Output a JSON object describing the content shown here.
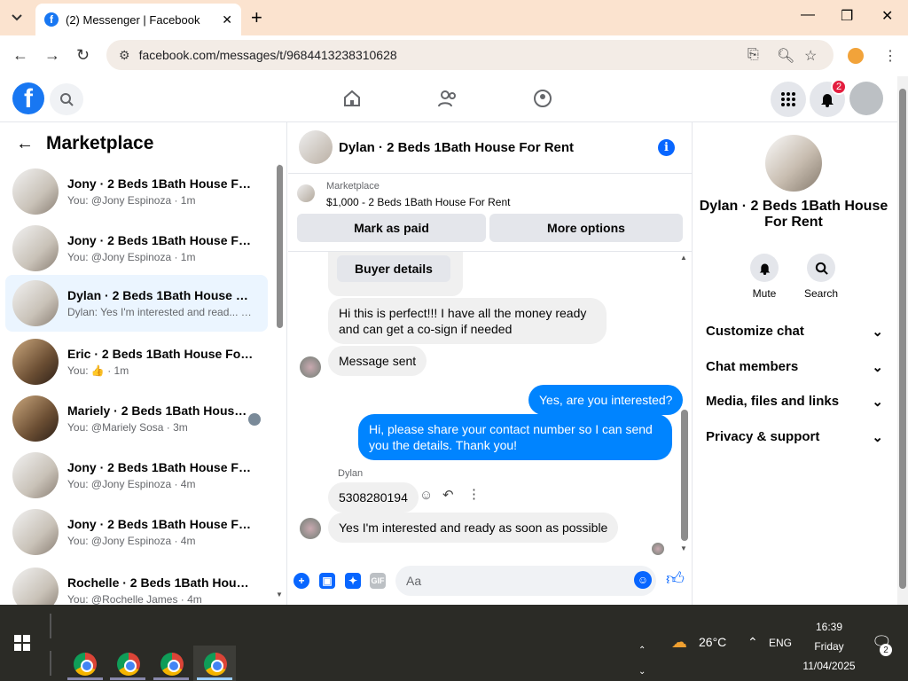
{
  "browser": {
    "tab_title": "(2) Messenger | Facebook",
    "url": "facebook.com/messages/t/9684413238310628"
  },
  "fb_header": {
    "notif_count": "2"
  },
  "left": {
    "title": "Marketplace",
    "conversations": [
      {
        "name": "Jony · 2 Beds 1Bath House For R...",
        "sub": "You: @Jony Espinoza · 1m"
      },
      {
        "name": "Jony · 2 Beds 1Bath House For R...",
        "sub": "You: @Jony Espinoza · 1m"
      },
      {
        "name": "Dylan · 2 Beds 1Bath House For ...",
        "sub": "Dylan: Yes I'm interested and read... · 1m"
      },
      {
        "name": "Eric · 2 Beds 1Bath House For Rent",
        "sub": "You: 👍 · 1m"
      },
      {
        "name": "Mariely · 2 Beds 1Bath House ...",
        "sub": "You: @Mariely Sosa · 3m"
      },
      {
        "name": "Jony · 2 Beds 1Bath House For R...",
        "sub": "You: @Jony Espinoza · 4m"
      },
      {
        "name": "Jony · 2 Beds 1Bath House For R...",
        "sub": "You: @Jony Espinoza · 4m"
      },
      {
        "name": "Rochelle · 2 Beds 1Bath House F...",
        "sub": "You: @Rochelle James · 4m"
      }
    ]
  },
  "chat": {
    "title": "Dylan · 2 Beds 1Bath House For Rent",
    "marketplace_label": "Marketplace",
    "listing": "$1,000 - 2 Beds 1Bath House For Rent",
    "mark_paid": "Mark as paid",
    "more_options": "More options",
    "buyer_details": "Buyer details",
    "messages": {
      "in1": "Hi this is perfect!!! I have all the money ready and can get a co-sign if needed",
      "in2": "Message sent",
      "out1": "Yes, are you interested?",
      "out2": "Hi, please share your contact number so I can send you the details. Thank you!",
      "sender": "Dylan",
      "in3": "5308280194",
      "in4": "Yes I'm interested and ready as soon as possible"
    },
    "composer_placeholder": "Aa",
    "gif": "GIF"
  },
  "right": {
    "name": "Dylan · 2 Beds 1Bath House For Rent",
    "mute": "Mute",
    "search": "Search",
    "sections": [
      "Customize chat",
      "Chat members",
      "Media, files and links",
      "Privacy & support"
    ]
  },
  "taskbar": {
    "weather": "26°C",
    "lang": "ENG",
    "time": "16:39",
    "day": "Friday",
    "date": "11/04/2025",
    "notif": "2"
  }
}
